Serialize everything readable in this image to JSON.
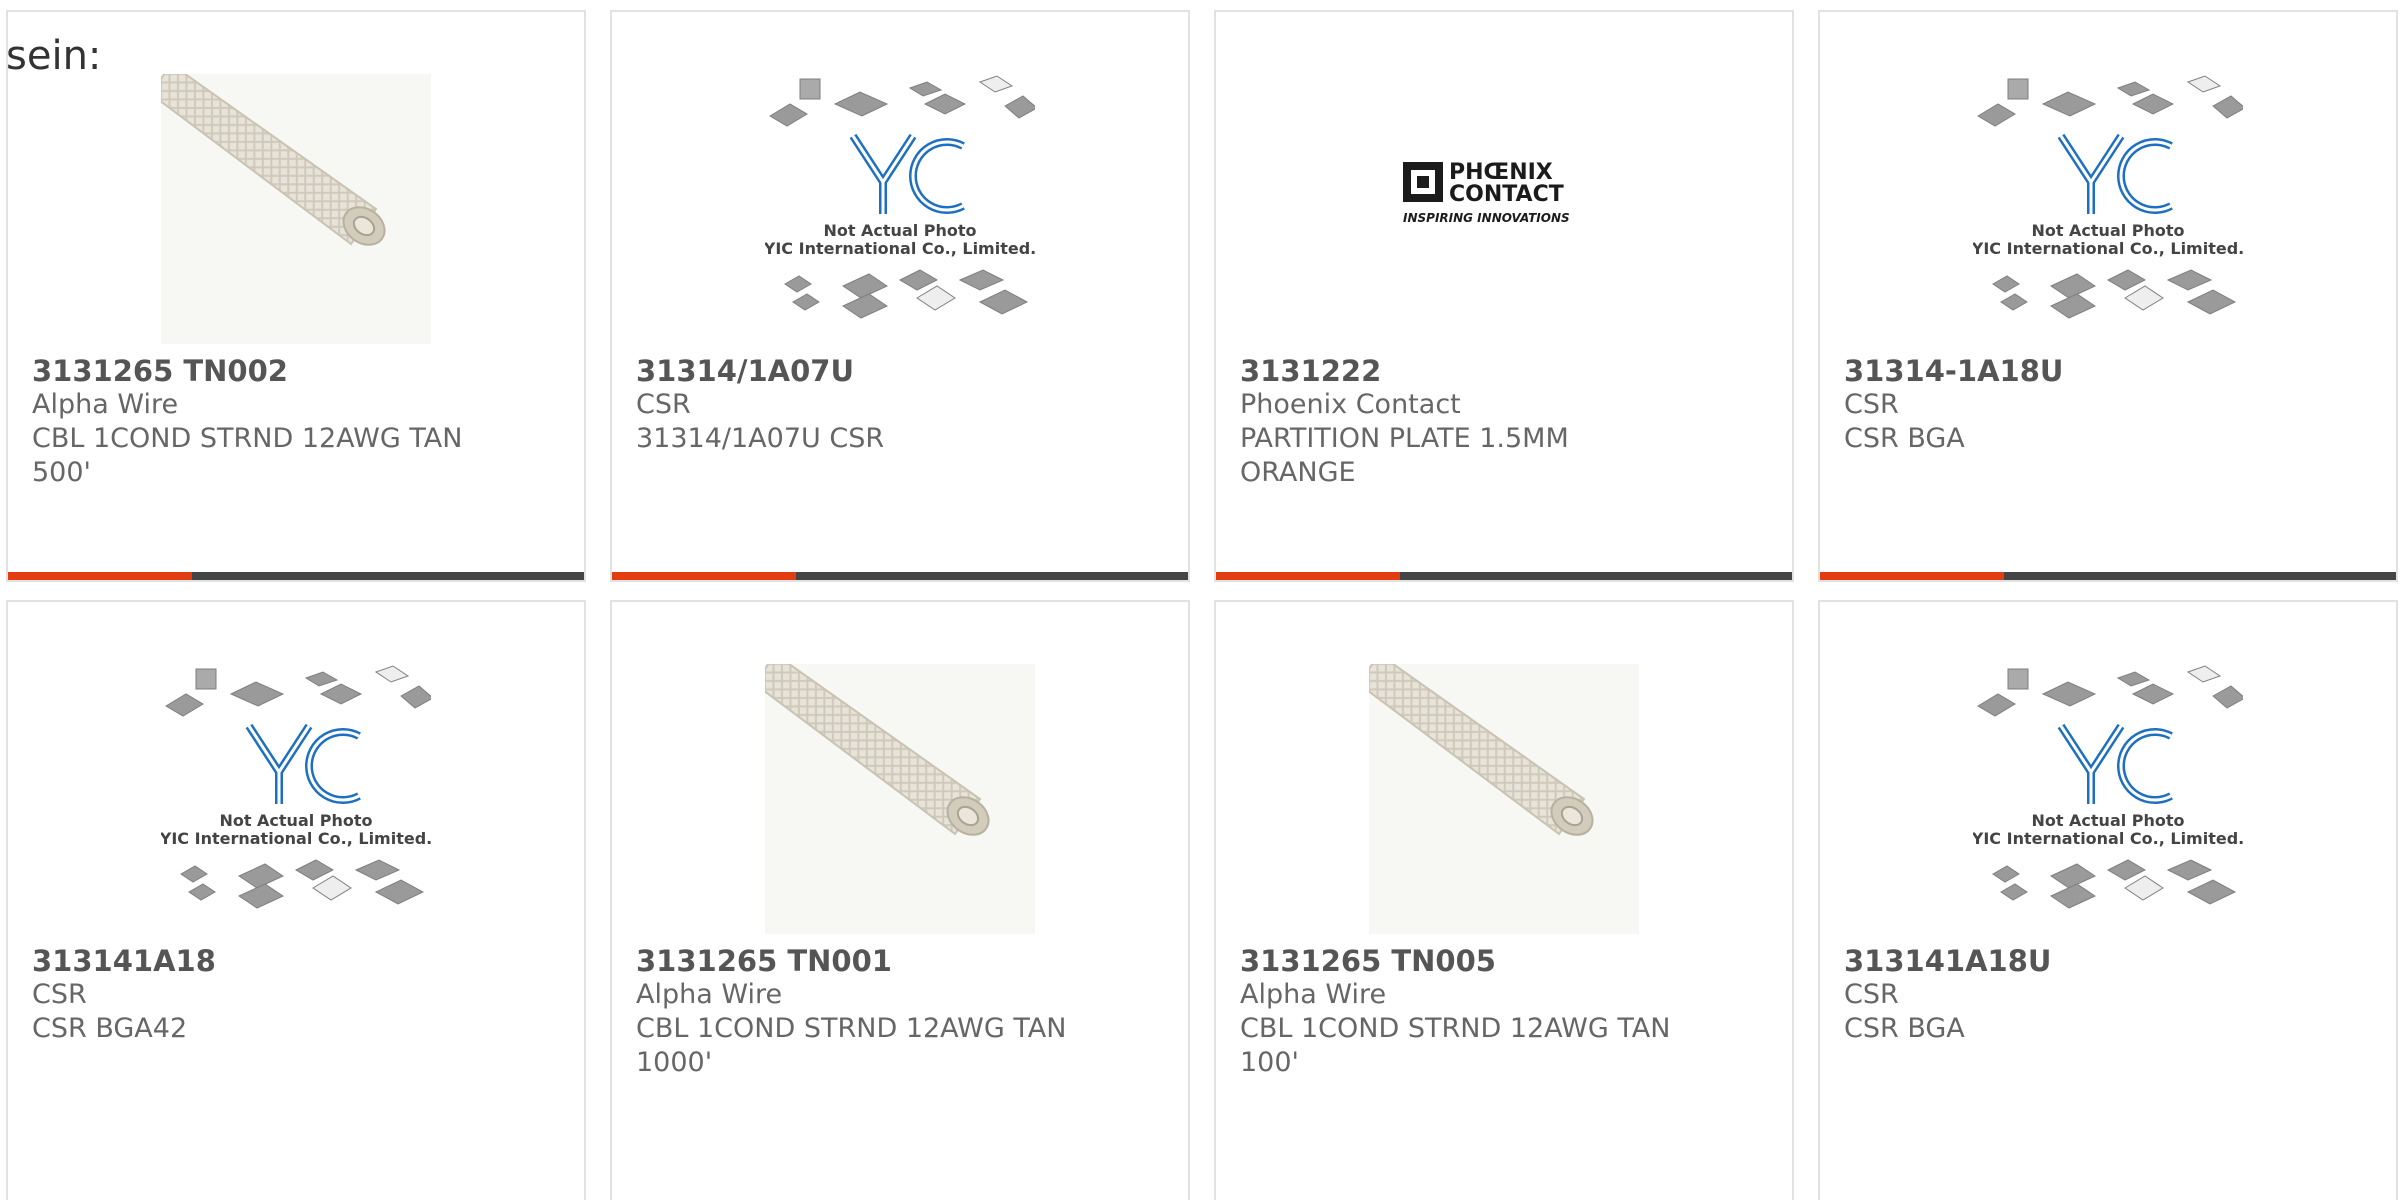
{
  "lead_text": "sein:",
  "colors": {
    "accent": "#e23c12",
    "bar_track": "#444444"
  },
  "rows": [
    {
      "cards": [
        {
          "image": "cable-photo",
          "part": "3131265 TN002",
          "maker": "Alpha Wire",
          "desc": "CBL 1COND STRND 12AWG TAN\n500'",
          "progress": 0.32
        },
        {
          "image": "yic-placeholder",
          "part": "31314/1A07U",
          "maker": "CSR",
          "desc": "31314/1A07U CSR",
          "progress": 0.32
        },
        {
          "image": "phoenix-logo",
          "part": "3131222",
          "maker": "Phoenix Contact",
          "desc": "PARTITION PLATE 1.5MM\nORANGE",
          "progress": 0.32
        },
        {
          "image": "yic-placeholder",
          "part": "31314-1A18U",
          "maker": "CSR",
          "desc": "CSR BGA",
          "progress": 0.32
        }
      ]
    },
    {
      "cards": [
        {
          "image": "yic-placeholder",
          "part": "313141A18",
          "maker": "CSR",
          "desc": "CSR BGA42"
        },
        {
          "image": "cable-photo",
          "part": "3131265 TN001",
          "maker": "Alpha Wire",
          "desc": "CBL 1COND STRND 12AWG TAN\n1000'"
        },
        {
          "image": "cable-photo",
          "part": "3131265 TN005",
          "maker": "Alpha Wire",
          "desc": "CBL 1COND STRND 12AWG TAN\n100'"
        },
        {
          "image": "yic-placeholder",
          "part": "313141A18U",
          "maker": "CSR",
          "desc": "CSR BGA"
        }
      ]
    }
  ],
  "placeholder_texts": {
    "yic_line1": "Not Actual Photo",
    "yic_line2": "YIC International Co., Limited.",
    "yic_logo": "YIC",
    "phoenix_line1": "PHŒNIX",
    "phoenix_line2": "CONTACT",
    "phoenix_tagline": "INSPIRING INNOVATIONS"
  }
}
